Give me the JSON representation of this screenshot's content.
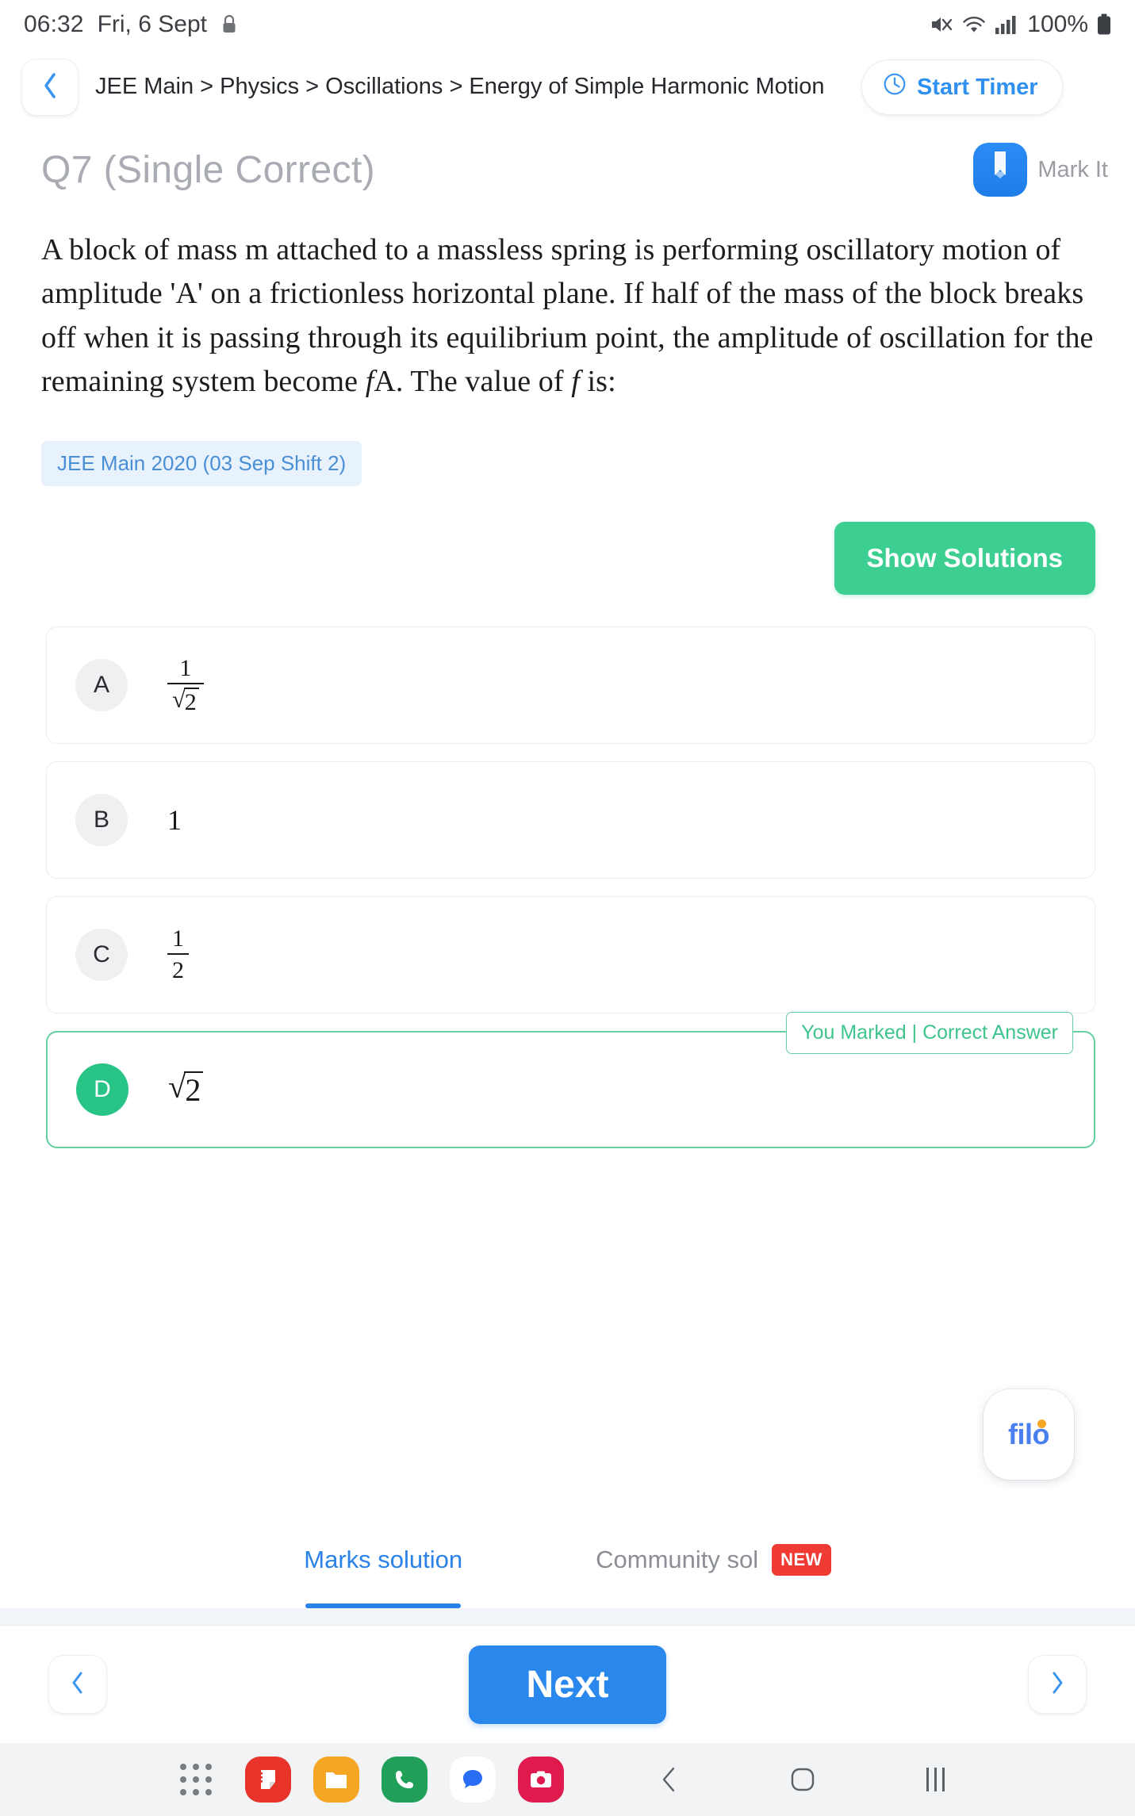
{
  "status_bar": {
    "time": "06:32",
    "date": "Fri, 6 Sept",
    "lock_icon": "lock-icon",
    "mute_icon": "mute-icon",
    "wifi_icon": "wifi-icon",
    "signal_icon": "signal-bars-icon",
    "battery_percent": "100%",
    "battery_icon": "battery-full-icon"
  },
  "header": {
    "back_icon": "chevron-left-icon",
    "breadcrumb": "JEE Main > Physics > Oscillations > Energy of Simple Harmonic Motion",
    "timer_label": "Start Timer",
    "timer_icon": "clock-icon"
  },
  "question_header": {
    "title": "Q7 (Single Correct)",
    "mark_label": "Mark It",
    "mark_icon": "bookmark-icon"
  },
  "question": {
    "text_part_1": "A block of mass m attached to a massless spring is performing oscillatory motion of amplitude 'A' on a frictionless horizontal plane. If half of the mass of the block breaks off when it is passing through its equilibrium point, the amplitude of oscillation for the remaining system become ",
    "symbol_f_1": "f",
    "text_part_2": "A. The value of ",
    "symbol_f_2": "f",
    "text_part_3": " is:",
    "tag": "JEE Main 2020 (03 Sep Shift 2)"
  },
  "actions": {
    "show_solutions": "Show Solutions"
  },
  "options": [
    {
      "letter": "A",
      "type": "fraction",
      "numerator": "1",
      "denominator": "√2",
      "den_radicand": "2",
      "state": "normal"
    },
    {
      "letter": "B",
      "type": "plain",
      "value": "1",
      "state": "normal"
    },
    {
      "letter": "C",
      "type": "fraction",
      "numerator": "1",
      "denominator": "2",
      "state": "normal"
    },
    {
      "letter": "D",
      "type": "sqrt",
      "radicand": "2",
      "state": "correct",
      "flag": "You Marked | Correct Answer"
    }
  ],
  "filo": {
    "logo_text": "filo"
  },
  "tabs": [
    {
      "label": "Marks solution",
      "active": true,
      "badge": ""
    },
    {
      "label": "Community sol",
      "active": false,
      "badge": "NEW"
    }
  ],
  "bottom_nav": {
    "prev_icon": "chevron-left-icon",
    "next_label": "Next",
    "forward_icon": "chevron-right-icon"
  },
  "taskbar": {
    "apps_grid_icon": "app-grid-icon",
    "apps": [
      {
        "name": "notes-app-icon",
        "color": "#e8332a"
      },
      {
        "name": "files-app-icon",
        "color": "#f5a623"
      },
      {
        "name": "phone-app-icon",
        "color": "#21a05a"
      },
      {
        "name": "messages-app-icon",
        "color": "#ffffff"
      },
      {
        "name": "camera-app-icon",
        "color": "#e0194f"
      }
    ],
    "system": {
      "back_icon": "back-chevron-icon",
      "home_icon": "home-square-icon",
      "recents_icon": "recents-bars-icon"
    }
  },
  "colors": {
    "accent_blue": "#2a82e8",
    "green": "#3ccf91",
    "correct_green": "#28c486",
    "tag_blue": "#4a8fd6",
    "red_badge": "#f03b35"
  }
}
